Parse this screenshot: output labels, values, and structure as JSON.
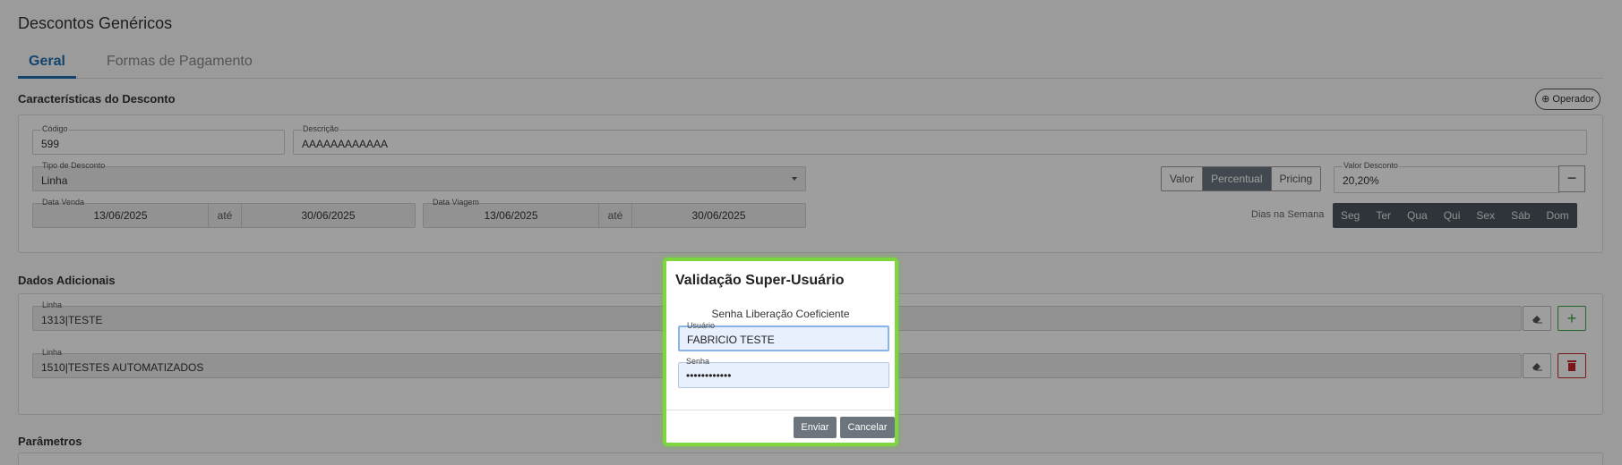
{
  "page": {
    "title": "Descontos Genéricos",
    "tabs": [
      {
        "label": "Geral",
        "active": true
      },
      {
        "label": "Formas de Pagamento",
        "active": false
      }
    ]
  },
  "caracteristicas": {
    "section_title": "Características do Desconto",
    "operador_label": "Operador",
    "codigo": {
      "label": "Código",
      "value": "599"
    },
    "descricao": {
      "label": "Descrição",
      "value": "AAAAAAAAAAAA"
    },
    "tipo_desconto": {
      "label": "Tipo de Desconto",
      "value": "Linha"
    },
    "tipo_valor_options": [
      "Valor",
      "Percentual",
      "Pricing"
    ],
    "tipo_valor_selected": "Percentual",
    "valor_desconto": {
      "label": "Valor Desconto",
      "value": "20,20%"
    },
    "data_venda": {
      "label": "Data Venda",
      "from": "13/06/2025",
      "sep": "até",
      "to": "30/06/2025"
    },
    "data_viagem": {
      "label": "Data Viagem",
      "from": "13/06/2025",
      "sep": "até",
      "to": "30/06/2025"
    },
    "dias_label": "Dias na Semana",
    "dias": [
      "Seg",
      "Ter",
      "Qua",
      "Qui",
      "Sex",
      "Sáb",
      "Dom"
    ]
  },
  "dados_adicionais": {
    "section_title": "Dados Adicionais",
    "linhas": [
      {
        "label": "Linha",
        "value": "1313|TESTE"
      },
      {
        "label": "Linha",
        "value": "1510|TESTES AUTOMATIZADOS"
      }
    ]
  },
  "parametros": {
    "section_title": "Parâmetros"
  },
  "modal": {
    "title": "Validação Super-Usuário",
    "subtitle": "Senha Liberação Coeficiente",
    "usuario": {
      "label": "Usuário",
      "value": "FABRICIO TESTE"
    },
    "senha": {
      "label": "Senha",
      "value": "••••••••••••"
    },
    "enviar": "Enviar",
    "cancelar": "Cancelar"
  },
  "colors": {
    "accent": "#1f6fb2",
    "modal_border": "#7ed63f",
    "button": "#6c757d",
    "add": "#3aa24a",
    "delete": "#c62828"
  }
}
